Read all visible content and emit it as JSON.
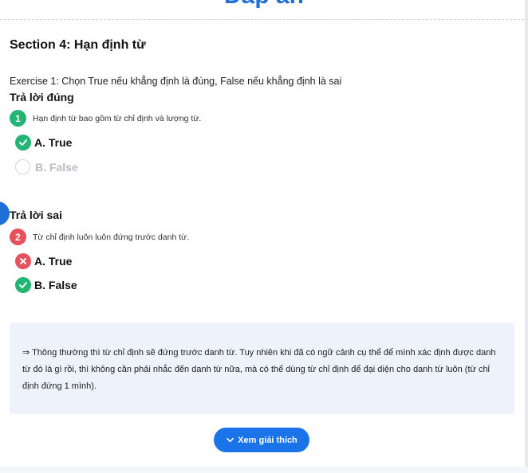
{
  "header": {
    "title": "Đáp án"
  },
  "section": {
    "title": "Section 4: Hạn định từ",
    "exercise": "Exercise 1: Chọn True nếu khẳng định là đúng, False nếu khẳng định là sai"
  },
  "correct_block": {
    "heading": "Trả lời đúng",
    "question_number": "1",
    "question_text": "Hạn định từ bao gồm từ chỉ định và lượng từ.",
    "options": [
      {
        "label": "A. True",
        "state": "correct",
        "icon": "check-icon"
      },
      {
        "label": "B. False",
        "state": "unselected",
        "icon": "empty-circle-icon"
      }
    ]
  },
  "wrong_block": {
    "heading": "Trả lời sai",
    "question_number": "2",
    "question_text": "Từ chỉ định luôn luôn đứng trước danh từ.",
    "options": [
      {
        "label": "A. True",
        "state": "wrong",
        "icon": "cross-icon"
      },
      {
        "label": "B. False",
        "state": "correct",
        "icon": "check-icon"
      }
    ]
  },
  "explanation": {
    "text": "⇒ Thông thường thì từ chỉ định sẽ đứng trước danh từ. Tuy nhiên khi đã  có ngữ cảnh cụ thể để mình xác định được danh từ đó là gì rồi, thì không cần phải nhắc đến danh từ nữa, mà có thể dùng từ chỉ định để đại diện cho danh từ luôn (từ chỉ định đứng 1 mình)."
  },
  "button": {
    "label": "Xem giải thích",
    "icon": "chevron-down-icon"
  },
  "colors": {
    "accent": "#1a73e8",
    "correct": "#22b573",
    "wrong": "#e8505b",
    "muted": "#b8bec6",
    "explain_bg": "#eef3fb"
  }
}
